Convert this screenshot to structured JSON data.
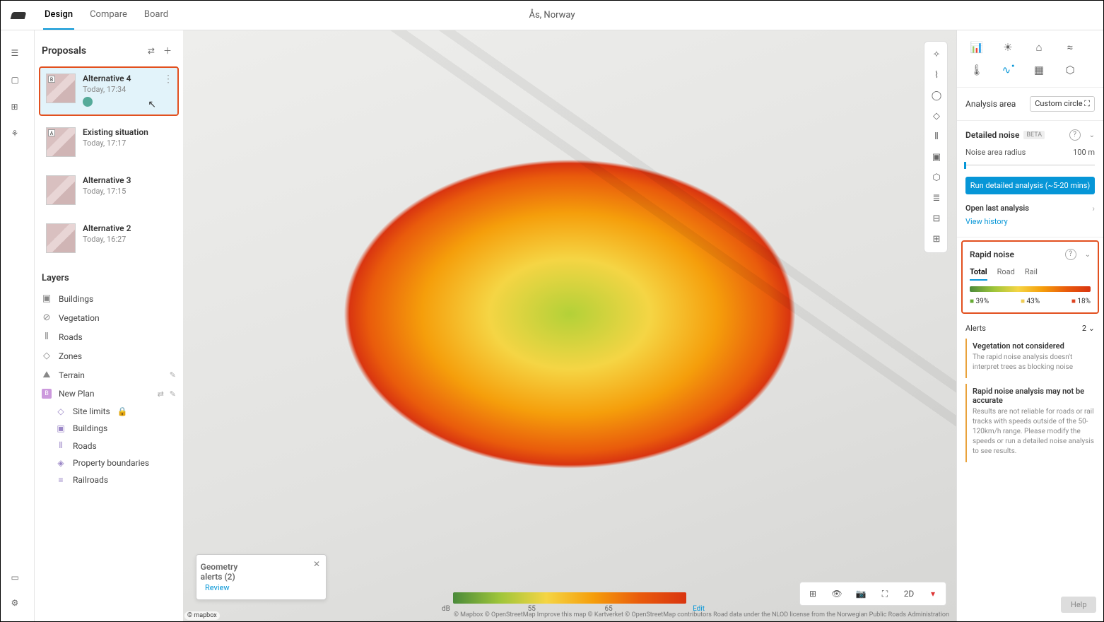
{
  "header": {
    "tabs": [
      "Design",
      "Compare",
      "Board"
    ],
    "location": "Ås, Norway"
  },
  "sidebar": {
    "title": "Proposals",
    "proposals": [
      {
        "badge": "B",
        "name": "Alternative 4",
        "time": "Today, 17:34",
        "selected": true,
        "avatar": true
      },
      {
        "badge": "A",
        "name": "Existing situation",
        "time": "Today, 17:17"
      },
      {
        "badge": "",
        "name": "Alternative 3",
        "time": "Today, 17:15"
      },
      {
        "badge": "",
        "name": "Alternative 2",
        "time": "Today, 16:27"
      }
    ],
    "layers_title": "Layers",
    "layers": [
      {
        "icon": "▣",
        "name": "Buildings"
      },
      {
        "icon": "⊘",
        "name": "Vegetation"
      },
      {
        "icon": "⦀",
        "name": "Roads"
      },
      {
        "icon": "◇",
        "name": "Zones"
      },
      {
        "icon": "⛰",
        "name": "Terrain",
        "edit": true
      }
    ],
    "newplan": {
      "badge": "B",
      "name": "New Plan"
    },
    "sublayers": [
      {
        "icon": "◇",
        "name": "Site limits",
        "lock": true
      },
      {
        "icon": "▣",
        "name": "Buildings"
      },
      {
        "icon": "⦀",
        "name": "Roads"
      },
      {
        "icon": "◈",
        "name": "Property boundaries"
      },
      {
        "icon": "≡",
        "name": "Railroads"
      }
    ]
  },
  "toast": {
    "title": "Geometry alerts (2)",
    "action": "Review"
  },
  "legend": {
    "left": "dB",
    "v1": "55",
    "v2": "65",
    "edit": "Edit"
  },
  "view": {
    "mode": "2D"
  },
  "attribution": "© Mapbox © OpenStreetMap Improve this map © Kartverket © OpenStreetMap contributors Road data under the NLOD license from the Norwegian Public Roads Administration",
  "mapbox": "© mapbox",
  "right": {
    "area_label": "Analysis area",
    "area_btn": "Custom circle ⛶",
    "detailed": {
      "title": "Detailed noise",
      "beta": "BETA",
      "radius_lbl": "Noise area radius",
      "radius_val": "100 m",
      "run": "Run detailed analysis (~5-20 mins)",
      "open": "Open last analysis",
      "history": "View history"
    },
    "rapid": {
      "title": "Rapid noise",
      "tabs": [
        "Total",
        "Road",
        "Rail"
      ],
      "pcts": {
        "g": "39%",
        "y": "43%",
        "r": "18%"
      }
    },
    "alerts": {
      "title": "Alerts",
      "count": "2",
      "items": [
        {
          "t": "Vegetation not considered",
          "d": "The rapid noise analysis doesn't interpret trees as blocking noise"
        },
        {
          "t": "Rapid noise analysis may not be accurate",
          "d": "Results are not reliable for roads or rail tracks with speeds outside of the 50-120km/h range. Please modify the speeds or run a detailed noise analysis to see results."
        }
      ]
    },
    "help": "Help"
  }
}
